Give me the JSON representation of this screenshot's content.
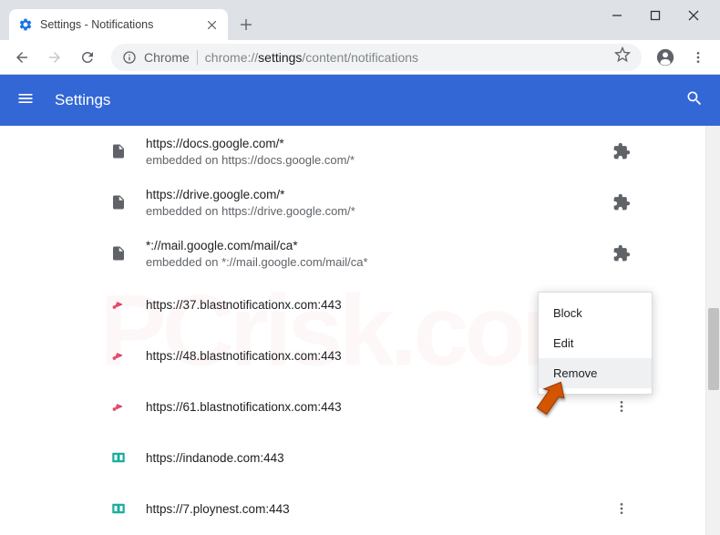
{
  "window": {
    "tab_title": "Settings - Notifications"
  },
  "toolbar": {
    "browser_prefix": "Chrome",
    "url_dim1": "chrome://",
    "url_strong": "settings",
    "url_dim2": "/content/notifications"
  },
  "app_header": {
    "title": "Settings"
  },
  "sites": [
    {
      "url": "https://docs.google.com/*",
      "sub": "embedded on https://docs.google.com/*",
      "icon": "doc",
      "action": "puzzle"
    },
    {
      "url": "https://drive.google.com/*",
      "sub": "embedded on https://drive.google.com/*",
      "icon": "doc",
      "action": "puzzle"
    },
    {
      "url": "*://mail.google.com/mail/ca*",
      "sub": "embedded on *://mail.google.com/mail/ca*",
      "icon": "doc",
      "action": "puzzle"
    },
    {
      "url": "https://37.blastnotificationx.com:443",
      "sub": "",
      "icon": "notify",
      "action": "none"
    },
    {
      "url": "https://48.blastnotificationx.com:443",
      "sub": "",
      "icon": "notify",
      "action": "none"
    },
    {
      "url": "https://61.blastnotificationx.com:443",
      "sub": "",
      "icon": "notify",
      "action": "more"
    },
    {
      "url": "https://indanode.com:443",
      "sub": "",
      "icon": "teal",
      "action": "none"
    },
    {
      "url": "https://7.ploynest.com:443",
      "sub": "",
      "icon": "teal",
      "action": "more"
    }
  ],
  "context_menu": {
    "items": [
      {
        "label": "Block",
        "highlighted": false
      },
      {
        "label": "Edit",
        "highlighted": false
      },
      {
        "label": "Remove",
        "highlighted": true
      }
    ]
  }
}
